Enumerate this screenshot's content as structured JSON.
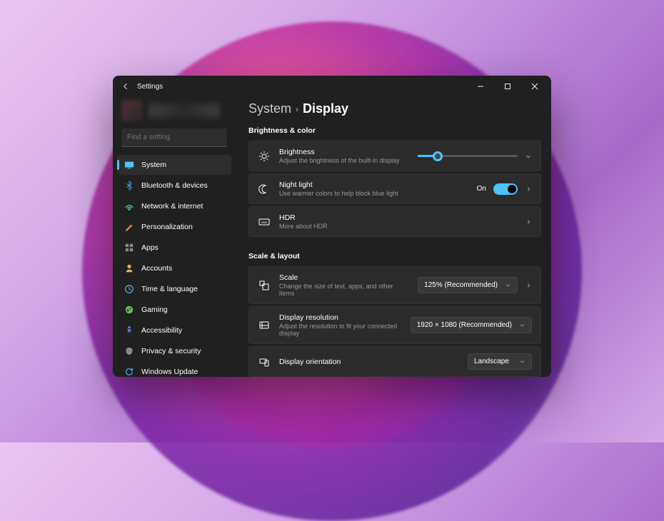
{
  "app": {
    "title": "Settings"
  },
  "search": {
    "placeholder": "Find a setting"
  },
  "sidebar": {
    "items": [
      {
        "label": "System",
        "icon": "system",
        "selected": true
      },
      {
        "label": "Bluetooth & devices",
        "icon": "bluetooth"
      },
      {
        "label": "Network & internet",
        "icon": "network"
      },
      {
        "label": "Personalization",
        "icon": "personalization"
      },
      {
        "label": "Apps",
        "icon": "apps"
      },
      {
        "label": "Accounts",
        "icon": "accounts"
      },
      {
        "label": "Time & language",
        "icon": "time"
      },
      {
        "label": "Gaming",
        "icon": "gaming"
      },
      {
        "label": "Accessibility",
        "icon": "accessibility"
      },
      {
        "label": "Privacy & security",
        "icon": "privacy"
      },
      {
        "label": "Windows Update",
        "icon": "update"
      }
    ]
  },
  "breadcrumb": {
    "parent": "System",
    "current": "Display"
  },
  "sections": {
    "brightness_color": {
      "title": "Brightness & color",
      "brightness": {
        "title": "Brightness",
        "sub": "Adjust the brightness of the built-in display",
        "value_pct": 20
      },
      "nightlight": {
        "title": "Night light",
        "sub": "Use warmer colors to help block blue light",
        "state": "On"
      },
      "hdr": {
        "title": "HDR",
        "sub": "More about HDR"
      }
    },
    "scale_layout": {
      "title": "Scale & layout",
      "scale": {
        "title": "Scale",
        "sub": "Change the size of text, apps, and other items",
        "value": "125% (Recommended)"
      },
      "resolution": {
        "title": "Display resolution",
        "sub": "Adjust the resolution to fit your connected display",
        "value": "1920 × 1080 (Recommended)"
      },
      "orientation": {
        "title": "Display orientation",
        "value": "Landscape"
      }
    }
  }
}
